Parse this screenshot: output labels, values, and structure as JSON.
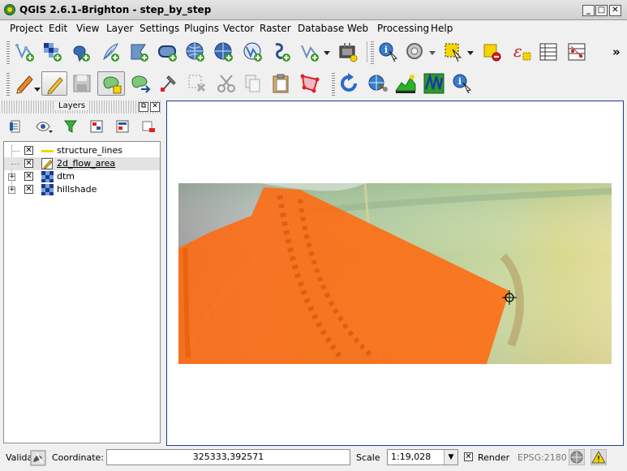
{
  "window": {
    "title": "QGIS 2.6.1-Brighton - step_by_step",
    "min": "_",
    "max": "□",
    "close": "✕"
  },
  "menu": [
    "Project",
    "Edit",
    "View",
    "Layer",
    "Settings",
    "Plugins",
    "Vector",
    "Raster",
    "Database",
    "Web",
    "Processing",
    "Help"
  ],
  "toolbar_overflow": "»",
  "layers_panel": {
    "title": "Layers",
    "layers": [
      {
        "name": "structure_lines",
        "checked": true,
        "type": "line",
        "color": "#f5d400"
      },
      {
        "name": "2d_flow_area",
        "checked": true,
        "type": "polygon",
        "selected": true
      },
      {
        "name": "dtm",
        "checked": true,
        "type": "raster",
        "expandable": true
      },
      {
        "name": "hillshade",
        "checked": true,
        "type": "raster",
        "expandable": true
      }
    ]
  },
  "status": {
    "validate_label": "Valida",
    "coordinate_label": "Coordinate:",
    "coordinate_value": "325333,392571",
    "scale_label": "Scale",
    "scale_value": "1:19,028",
    "render_label": "Render",
    "render_checked": true,
    "epsg": "EPSG:2180"
  },
  "colors": {
    "flow_area": "#ff6a10",
    "map_frame": "#1e3a8a",
    "selected_row": "#e3e3e3"
  }
}
